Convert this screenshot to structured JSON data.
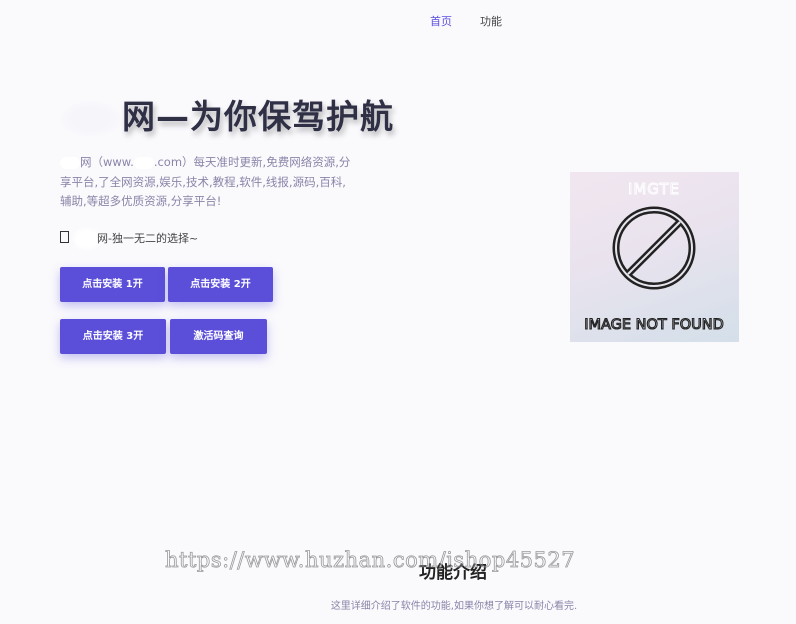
{
  "nav": {
    "items": [
      {
        "label": "首页",
        "active": true
      },
      {
        "label": "功能",
        "active": false
      }
    ]
  },
  "hero": {
    "title": "网—为你保驾护航",
    "description_prefix": "网（www.",
    "description_suffix": ".com）每天准时更新,免费网络资源,分享平台,了全网资源,娱乐,技术,教程,软件,线报,源码,百科,辅助,等超多优质资源,分享平台!",
    "tagline": "网-独一无二的选择~"
  },
  "buttons": {
    "install_1": "点击安装 1开",
    "install_2": "点击安装 2开",
    "install_3": "点击安装 3开",
    "activation_query": "激活码查询"
  },
  "image": {
    "top_text": "IMGTE",
    "bottom_text": "IMAGE NOT FOUND"
  },
  "features": {
    "title": "功能介绍",
    "subtitle": "这里详细介绍了软件的功能,如果你想了解可以耐心看完."
  },
  "watermark": "https://www.huzhan.com/ishop45527",
  "colors": {
    "accent": "#5b4fd9",
    "background": "#fafafd",
    "title": "#2f2f45",
    "muted_text": "#8a84a8"
  }
}
